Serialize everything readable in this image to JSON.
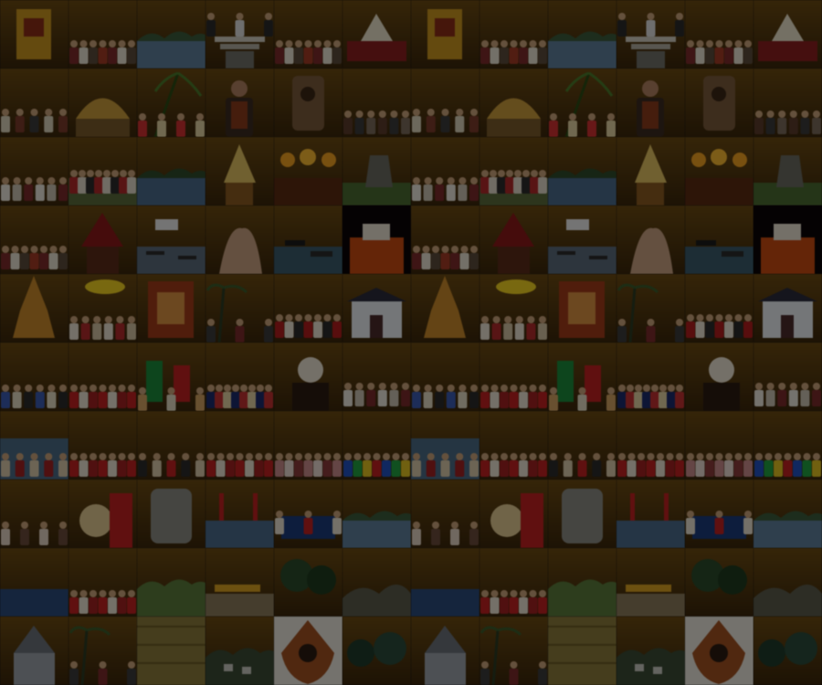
{
  "mosaic": {
    "columns": 12,
    "rows": 10,
    "repeat_columns": 6,
    "dim_overlay": true,
    "tiles": [
      [
        "gold-altar",
        "crowd-ceremony",
        "lake-hills",
        "temple-steps",
        "crowd-ceremony",
        "red-stage"
      ],
      [
        "green-crowd",
        "golden-palace",
        "palm-garden",
        "costume-portrait",
        "wood-sculpture",
        "dark-procession"
      ],
      [
        "white-crowd",
        "field-gathering",
        "blue-lake",
        "golden-headdress",
        "fire-lights",
        "stone-field"
      ],
      [
        "crowd-ceremony",
        "red-roof-pagoda",
        "lake-boats",
        "hands-closeup",
        "river-boats",
        "red-theatre"
      ],
      [
        "golden-pagoda",
        "yellow-umbrella-crowd",
        "red-shrine",
        "palm-street",
        "red-procession",
        "white-house"
      ],
      [
        "blue-dancers",
        "red-dancers",
        "green-flags",
        "flag-crowd",
        "masked-figure",
        "white-crowd"
      ],
      [
        "lake-shore",
        "red-dancers",
        "dark-dancers",
        "red-dancers",
        "pink-dancers",
        "colorful-dancers"
      ],
      [
        "dark-portraits",
        "red-drum",
        "grey-statue",
        "red-bridge",
        "blue-stage",
        "lake-hills"
      ],
      [
        "sunset-sea",
        "red-dancers",
        "green-hills",
        "beach-boats",
        "dark-forest",
        "rock-field"
      ],
      [
        "grey-building",
        "palm-street",
        "straw-hut",
        "mountain-village",
        "wayang-shield",
        "night-forest"
      ]
    ]
  }
}
